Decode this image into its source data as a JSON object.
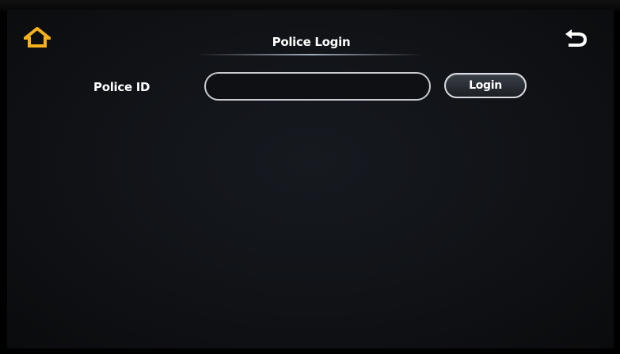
{
  "header": {
    "title": "Police Login",
    "home_icon": "home-icon",
    "back_icon": "back-arrow-icon",
    "accent_color": "#f5b21a",
    "back_icon_color": "#ffffff"
  },
  "form": {
    "id_label": "Police ID",
    "id_value": "",
    "login_label": "Login"
  }
}
